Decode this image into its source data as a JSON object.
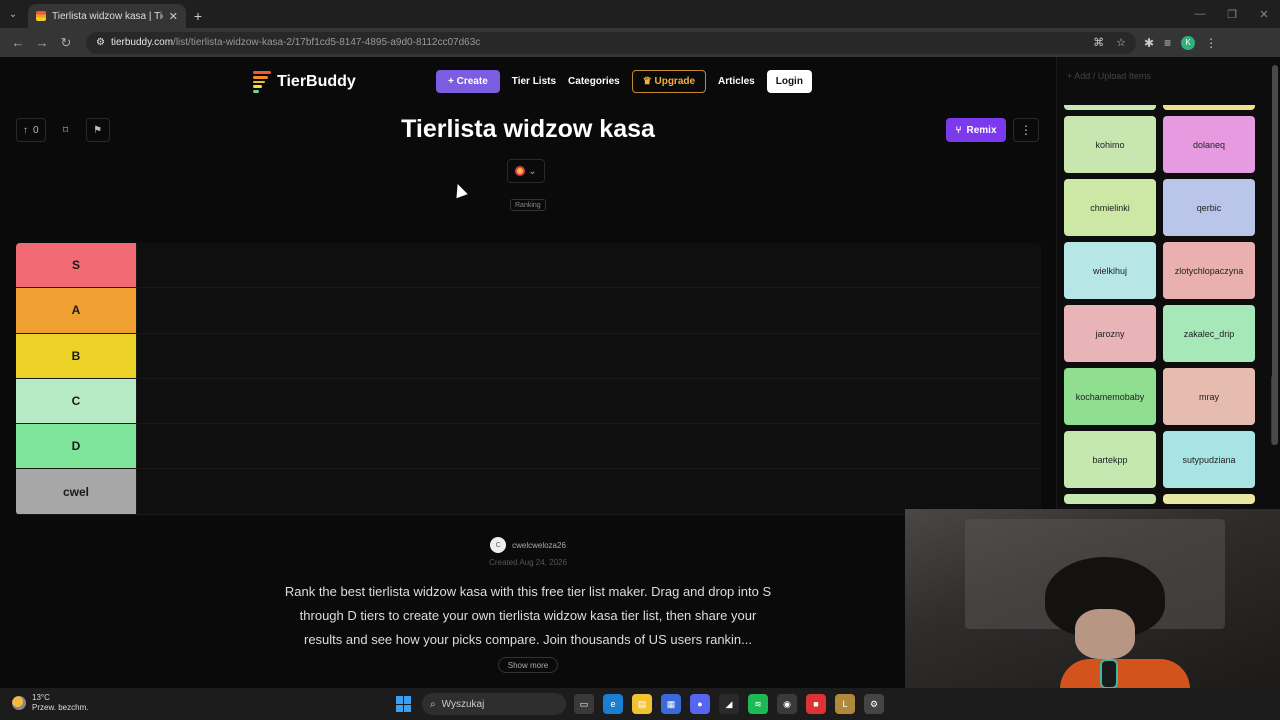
{
  "browser": {
    "tab_title": "Tierlista widzow kasa | TierBuddy",
    "new_tab": "+",
    "url_host": "tierbuddy.com",
    "url_path": "/list/tierlista-widzow-kasa-2/17bf1cd5-8147-4895-a9d0-8112cc07d63c",
    "profile_initial": "K"
  },
  "header": {
    "logo": "TierBuddy",
    "logo_colors": [
      "#f0563c",
      "#f08c20",
      "#f0c020",
      "#f0e040",
      "#6ad28a"
    ],
    "create": "Create",
    "create_icon": "+",
    "tier_lists": "Tier Lists",
    "categories": "Categories",
    "upgrade": "Upgrade",
    "articles": "Articles",
    "login": "Login"
  },
  "toolbar": {
    "upvote_count": "0"
  },
  "list": {
    "title": "Tierlista widzow kasa",
    "badge": "Ranking",
    "remix": "Remix",
    "tiers": [
      {
        "label": "S",
        "color": "#f26b74"
      },
      {
        "label": "A",
        "color": "#f0a030"
      },
      {
        "label": "B",
        "color": "#ecd226"
      },
      {
        "label": "C",
        "color": "#b6ebc6"
      },
      {
        "label": "D",
        "color": "#7ee49a"
      },
      {
        "label": "cwel",
        "color": "#a7a7a7"
      }
    ],
    "creator_initial": "C",
    "creator": "cwelcweloza26",
    "created": "Created Aug 24, 2026",
    "description": "Rank the best tierlista widzow kasa with this free tier list maker. Drag and drop into S through D tiers to create your own tierlista widzow kasa tier list, then share your results and see how your picks compare. Join thousands of US users rankin...",
    "show_more": "Show more"
  },
  "side": {
    "add_upload": "Add / Upload Items",
    "items": [
      {
        "name": "",
        "color": "#c8e6b0",
        "stub": true
      },
      {
        "name": "",
        "color": "#ece28a",
        "stub": true
      },
      {
        "name": "kohimo",
        "color": "#c8e6b0"
      },
      {
        "name": "dolaneq",
        "color": "#e69ae0"
      },
      {
        "name": "chmielinki",
        "color": "#cde8a4"
      },
      {
        "name": "qerbic",
        "color": "#b9c6ea"
      },
      {
        "name": "wielkihuj",
        "color": "#b6e6e6"
      },
      {
        "name": "zlotychlopaczyna",
        "color": "#eab0b0"
      },
      {
        "name": "jarozny",
        "color": "#e8b4b8"
      },
      {
        "name": "zakalec_drip",
        "color": "#a6e8b8"
      },
      {
        "name": "kochamemobaby",
        "color": "#90de90"
      },
      {
        "name": "mray",
        "color": "#e6bcb0"
      },
      {
        "name": "bartekpp",
        "color": "#c4e8b0"
      },
      {
        "name": "sutypudziana",
        "color": "#a8e4e4"
      },
      {
        "name": "",
        "color": "#c4e8b0",
        "stub": true
      },
      {
        "name": "",
        "color": "#e8e8a0",
        "stub": true
      }
    ]
  },
  "taskbar": {
    "temp": "13°C",
    "weather": "Przew. bezchm.",
    "search": "Wyszukaj",
    "apps": [
      {
        "name": "task-view",
        "color": "#3a3a3a",
        "glyph": "▭"
      },
      {
        "name": "edge",
        "color": "#1a7fd1",
        "glyph": "e"
      },
      {
        "name": "files",
        "color": "#f2c230",
        "glyph": "▤"
      },
      {
        "name": "store",
        "color": "#3a6ad8",
        "glyph": "▦"
      },
      {
        "name": "discord",
        "color": "#5865f2",
        "glyph": "●"
      },
      {
        "name": "app-dark",
        "color": "#2a2a2a",
        "glyph": "◢"
      },
      {
        "name": "spotify",
        "color": "#1db954",
        "glyph": "≋"
      },
      {
        "name": "chrome",
        "color": "#3a3a3a",
        "glyph": "◉"
      },
      {
        "name": "app-red",
        "color": "#d33",
        "glyph": "■"
      },
      {
        "name": "app-lol",
        "color": "#b08a3a",
        "glyph": "L"
      },
      {
        "name": "steam",
        "color": "#444",
        "glyph": "⚙"
      }
    ]
  }
}
